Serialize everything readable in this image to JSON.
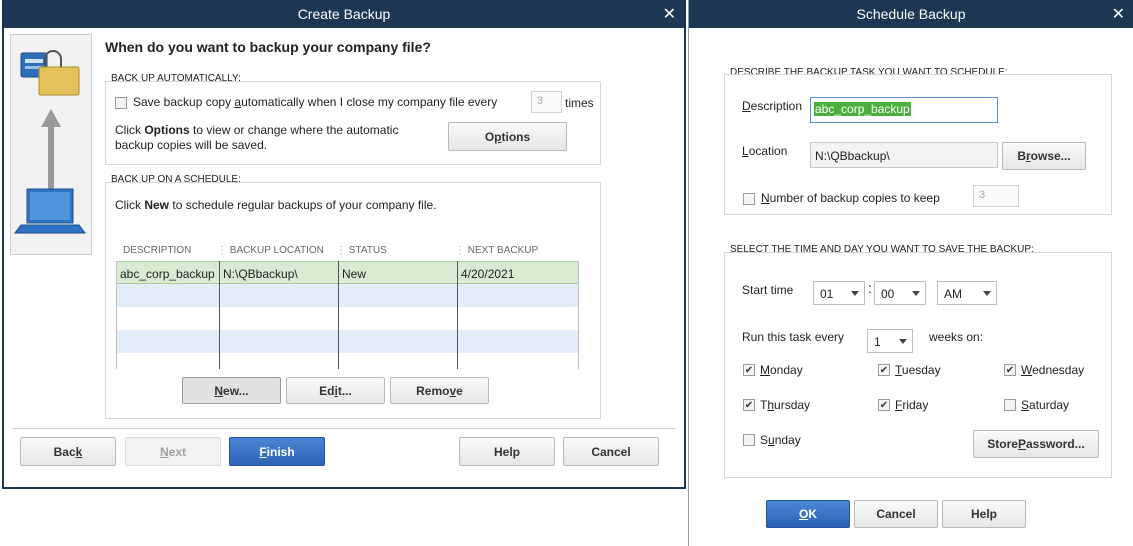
{
  "create": {
    "title": "Create Backup",
    "question": "When do you want to backup your company file?",
    "auto": {
      "heading": "BACK UP AUTOMATICALLY:",
      "checkbox_label_pre": "Save backup copy ",
      "checkbox_label_u": "a",
      "checkbox_label_post": "utomatically when I close my company file every",
      "times_value": "3",
      "times_label": "times",
      "info_pre": "Click ",
      "info_bold": "Options",
      "info_post": " to view or change where the automatic",
      "info_line2": "backup copies will be saved.",
      "options_pre": "O",
      "options_u": "p",
      "options_post": "tions"
    },
    "schedule": {
      "heading": "BACK UP ON A SCHEDULE:",
      "info_pre": "Click ",
      "info_bold": "New",
      "info_post": " to schedule regular backups of your company file.",
      "columns": [
        "DESCRIPTION",
        "BACKUP LOCATION",
        "STATUS",
        "NEXT BACKUP"
      ],
      "rows": [
        [
          "abc_corp_backup",
          "N:\\QBbackup\\",
          "New",
          "4/20/2021"
        ]
      ],
      "new_u": "N",
      "new_post": "ew...",
      "edit_pre": "Ed",
      "edit_u": "i",
      "edit_post": "t...",
      "remove_pre": "Remo",
      "remove_u": "v",
      "remove_post": "e"
    },
    "footer": {
      "back_pre": "Bac",
      "back_u": "k",
      "next_u": "N",
      "next_post": "ext",
      "finish_u": "F",
      "finish_post": "inish",
      "help": "Help",
      "cancel": "Cancel"
    }
  },
  "schedule": {
    "title": "Schedule Backup",
    "describe_heading": "DESCRIBE THE BACKUP TASK YOU WANT TO SCHEDULE:",
    "description_label_u": "D",
    "description_label_post": "escription",
    "description_value": "abc_corp_backup",
    "location_label_u": "L",
    "location_label_post": "ocation",
    "location_value": "N:\\QBbackup\\",
    "browse_pre": "B",
    "browse_u": "r",
    "browse_post": "owse...",
    "copies_u": "N",
    "copies_post": "umber of backup copies to keep",
    "copies_value": "3",
    "time_heading": "SELECT THE TIME AND DAY YOU WANT TO SAVE THE BACKUP:",
    "start_time_label": "Start time",
    "hour": "01",
    "minute": "00",
    "ampm": "AM",
    "colon": ":",
    "run_every_label": "Run this task every",
    "weeks": "1",
    "weeks_on_label": "weeks on:",
    "days": {
      "monday": {
        "u": "M",
        "post": "onday",
        "checked": true
      },
      "tuesday": {
        "u": "T",
        "post": "uesday",
        "checked": true
      },
      "wednesday": {
        "u": "W",
        "post": "ednesday",
        "checked": true
      },
      "thursday": {
        "pre": "T",
        "u": "h",
        "post": "ursday",
        "checked": true
      },
      "friday": {
        "u": "F",
        "post": "riday",
        "checked": true
      },
      "saturday": {
        "u": "S",
        "post": "aturday",
        "checked": false
      },
      "sunday": {
        "pre": "S",
        "u": "u",
        "post": "nday",
        "checked": false
      }
    },
    "store_password_pre": "Store ",
    "store_password_u": "P",
    "store_password_post": "assword...",
    "ok_u": "O",
    "ok_post": "K",
    "cancel": "Cancel",
    "help": "Help",
    "check_glyph": "✔"
  },
  "colors": {
    "titlebar": "#1c3654",
    "row_selected": "#d8ecd3",
    "row_alt": "#e3edf9",
    "primary_button": "#2c63b5",
    "description_highlight": "#4caf3d"
  }
}
